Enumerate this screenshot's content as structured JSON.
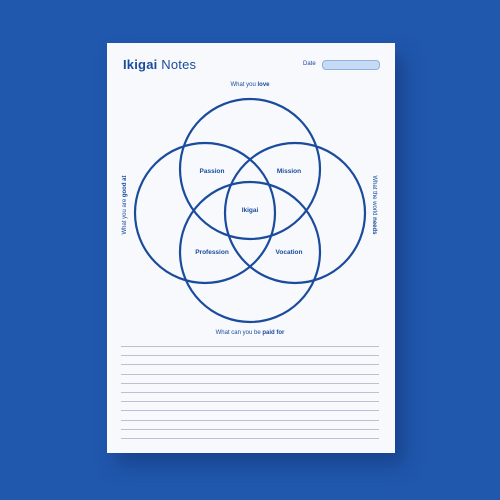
{
  "title_bold": "Ikigai",
  "title_rest": " Notes",
  "date_label": "Date",
  "outer_labels": {
    "top_pre": "What you ",
    "top_bold": "love",
    "left_pre": "What you are ",
    "left_bold": "good at",
    "right_pre": "What the world ",
    "right_bold": "needs",
    "bottom_pre": "What can you be ",
    "bottom_bold": "paid for"
  },
  "regions": {
    "passion": "Passion",
    "mission": "Mission",
    "center": "Ikigai",
    "profession": "Profession",
    "vocation": "Vocation"
  },
  "colors": {
    "background": "#2058ae",
    "accent": "#1a4b9c",
    "sheet": "#f7f9fc"
  },
  "line_count": 11
}
